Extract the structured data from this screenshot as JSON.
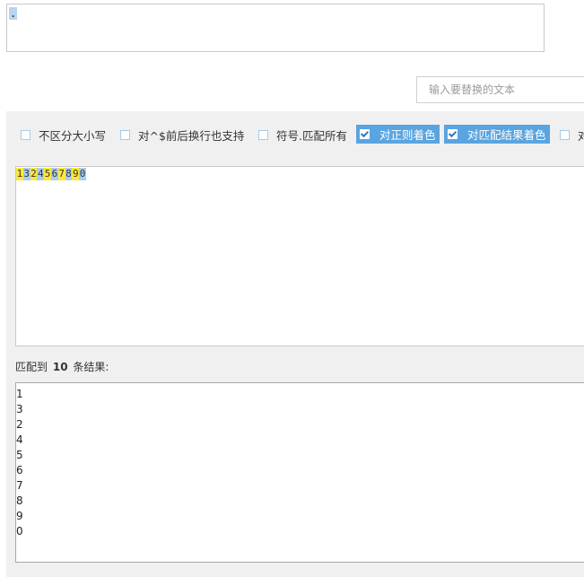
{
  "regex": {
    "value": "."
  },
  "replace": {
    "placeholder": "输入要替换的文本"
  },
  "options": [
    {
      "label": "不区分大小写",
      "checked": false
    },
    {
      "label": "对^$前后换行也支持",
      "checked": false
    },
    {
      "label": "符号.匹配所有",
      "checked": false
    },
    {
      "label": "对正则着色",
      "checked": true
    },
    {
      "label": "对匹配结果着色",
      "checked": true
    },
    {
      "label": "对",
      "checked": false
    }
  ],
  "test_text": {
    "chars": [
      "1",
      "3",
      "2",
      "4",
      "5",
      "6",
      "7",
      "8",
      "9",
      "0"
    ]
  },
  "result": {
    "prefix": "匹配到",
    "count": "10",
    "suffix": "条结果:",
    "items": [
      "1",
      "3",
      "2",
      "4",
      "5",
      "6",
      "7",
      "8",
      "9",
      "0"
    ]
  },
  "colors": {
    "highlight_yellow": "#ffe83a",
    "highlight_blue": "#a9cdee",
    "checked_bg": "#5aa4df"
  }
}
